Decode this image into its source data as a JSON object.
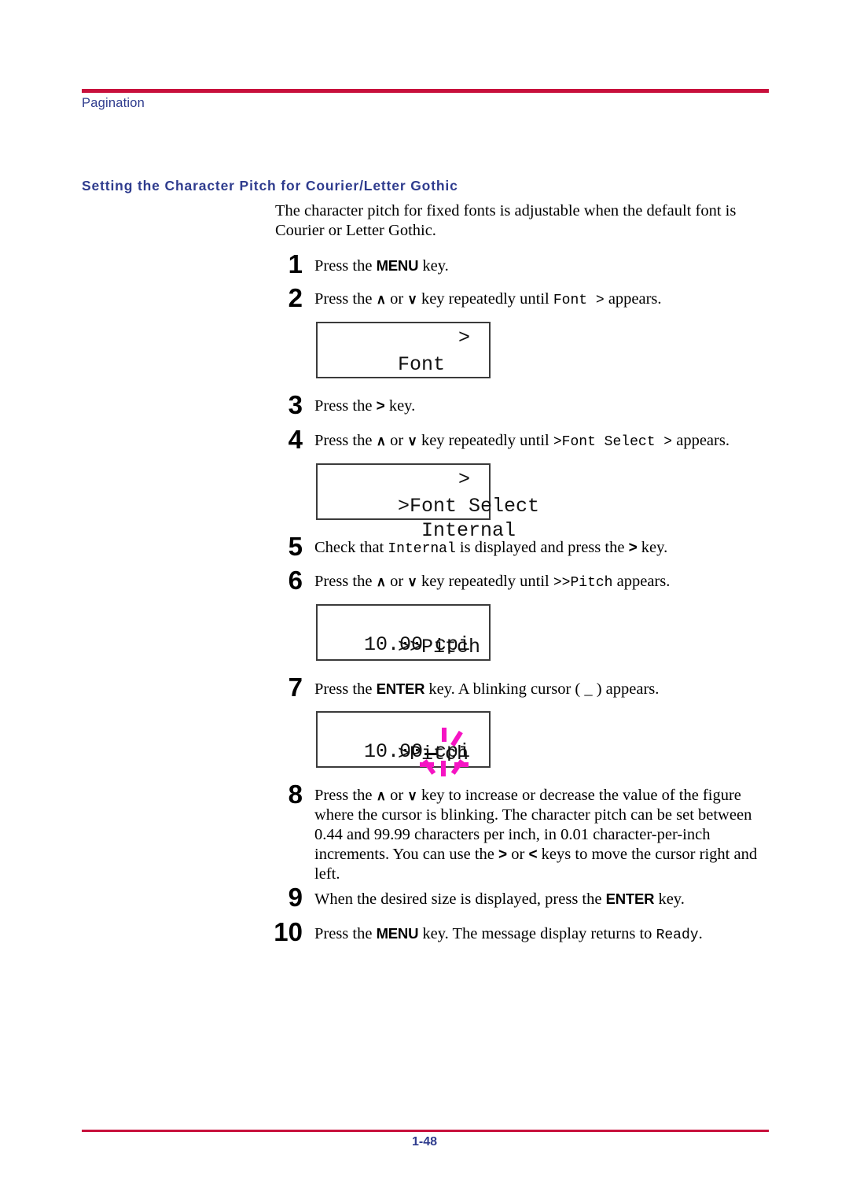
{
  "header": {
    "running_head": "Pagination",
    "rule_color": "#c8103c",
    "text_color": "#2f3c8e"
  },
  "section": {
    "heading": "Setting the Character Pitch for Courier/Letter Gothic",
    "intro": "The character pitch for fixed fonts is adjustable when the default font is Courier or Letter Gothic."
  },
  "steps": [
    {
      "number": "1",
      "parts": [
        {
          "type": "text",
          "value": "Press the "
        },
        {
          "type": "key",
          "value": "MENU"
        },
        {
          "type": "text",
          "value": " key."
        }
      ]
    },
    {
      "number": "2",
      "parts": [
        {
          "type": "text",
          "value": "Press the "
        },
        {
          "type": "arrow",
          "value": "∧"
        },
        {
          "type": "text",
          "value": " or "
        },
        {
          "type": "arrow",
          "value": "∨"
        },
        {
          "type": "text",
          "value": " key repeatedly until "
        },
        {
          "type": "lcd",
          "value": "Font >"
        },
        {
          "type": "text",
          "value": " appears."
        }
      ]
    },
    {
      "number": "3",
      "parts": [
        {
          "type": "text",
          "value": "Press the "
        },
        {
          "type": "gt",
          "value": ">"
        },
        {
          "type": "text",
          "value": " key."
        }
      ]
    },
    {
      "number": "4",
      "parts": [
        {
          "type": "text",
          "value": "Press the "
        },
        {
          "type": "arrow",
          "value": "∧"
        },
        {
          "type": "text",
          "value": " or "
        },
        {
          "type": "arrow",
          "value": "∨"
        },
        {
          "type": "text",
          "value": " key repeatedly until "
        },
        {
          "type": "lcd",
          "value": ">Font Select >"
        },
        {
          "type": "text",
          "value": " appears."
        }
      ]
    },
    {
      "number": "5",
      "parts": [
        {
          "type": "text",
          "value": "Check that "
        },
        {
          "type": "lcd",
          "value": "Internal"
        },
        {
          "type": "text",
          "value": " is displayed and press the "
        },
        {
          "type": "gt",
          "value": ">"
        },
        {
          "type": "text",
          "value": " key."
        }
      ]
    },
    {
      "number": "6",
      "parts": [
        {
          "type": "text",
          "value": "Press the "
        },
        {
          "type": "arrow",
          "value": "∧"
        },
        {
          "type": "text",
          "value": " or "
        },
        {
          "type": "arrow",
          "value": "∨"
        },
        {
          "type": "text",
          "value": " key repeatedly until "
        },
        {
          "type": "lcd",
          "value": ">>Pitch"
        },
        {
          "type": "text",
          "value": " appears."
        }
      ]
    },
    {
      "number": "7",
      "parts": [
        {
          "type": "text",
          "value": "Press the "
        },
        {
          "type": "key",
          "value": "ENTER"
        },
        {
          "type": "text",
          "value": " key. A blinking cursor ( _ ) appears."
        }
      ]
    },
    {
      "number": "8",
      "parts": [
        {
          "type": "text",
          "value": "Press the "
        },
        {
          "type": "arrow",
          "value": "∧"
        },
        {
          "type": "text",
          "value": " or "
        },
        {
          "type": "arrow",
          "value": "∨"
        },
        {
          "type": "text",
          "value": " key to increase or decrease the value of the figure where the cursor is blinking. The character pitch can be set between 0.44 and 99.99 characters per inch, in 0.01 character-per-inch increments. You can use the "
        },
        {
          "type": "gt",
          "value": ">"
        },
        {
          "type": "text",
          "value": " or "
        },
        {
          "type": "gt",
          "value": "<"
        },
        {
          "type": "text",
          "value": " keys to move the cursor right and left."
        }
      ]
    },
    {
      "number": "9",
      "parts": [
        {
          "type": "text",
          "value": "When the desired size is displayed, press the "
        },
        {
          "type": "key",
          "value": "ENTER"
        },
        {
          "type": "text",
          "value": " key."
        }
      ]
    },
    {
      "number": "10",
      "parts": [
        {
          "type": "text",
          "value": "Press the "
        },
        {
          "type": "key",
          "value": "MENU"
        },
        {
          "type": "text",
          "value": " key. The message display returns to "
        },
        {
          "type": "lcd",
          "value": "Ready"
        },
        {
          "type": "text",
          "value": "."
        }
      ]
    }
  ],
  "displays": [
    {
      "id": "display-font",
      "line1_left": "Font",
      "line1_right": ">",
      "line2_left": "",
      "line2_right": ""
    },
    {
      "id": "display-font-select",
      "line1_left": ">Font Select",
      "line1_right": ">",
      "line2_left": "  Internal",
      "line2_right": ""
    },
    {
      "id": "display-pitch",
      "line1_left": ">>Pitch",
      "line1_right": "",
      "line2_left": "",
      "line2_right": "10.00 cpi"
    },
    {
      "id": "display-pitch-cursor",
      "line1_left": ">Pitch",
      "line1_right": "",
      "line2_left": "",
      "line2_right": "10.00 cpi"
    }
  ],
  "blink_marker": {
    "color": "#f514c3",
    "label": "blinking-cursor-indicator"
  },
  "footer": {
    "page_number": "1-48",
    "rule_color": "#c8103c",
    "text_color": "#2f3c8e"
  }
}
